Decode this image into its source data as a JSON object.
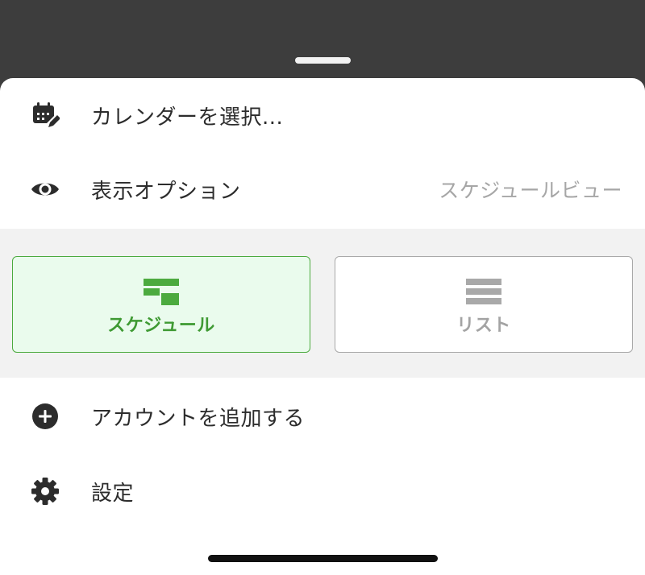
{
  "menu": {
    "select_calendar_label": "カレンダーを選択...",
    "display_options_label": "表示オプション",
    "display_options_value": "スケジュールビュー",
    "add_account_label": "アカウントを追加する",
    "settings_label": "設定"
  },
  "view_options": [
    {
      "label": "スケジュール",
      "selected": true,
      "icon": "schedule-icon"
    },
    {
      "label": "リスト",
      "selected": false,
      "icon": "list-icon"
    }
  ],
  "colors": {
    "accent": "#4caa3f",
    "selected_bg": "#eafbed",
    "icon_dark": "#2c2c2c",
    "inactive": "#a9a9a9"
  }
}
